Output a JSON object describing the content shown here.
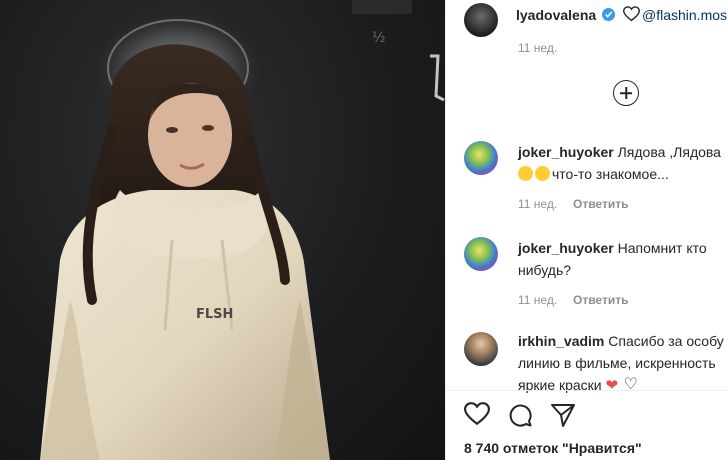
{
  "post": {
    "owner": "lyadovalena",
    "caption_mention": "@flashin.mos",
    "caption_time": "11 нед.",
    "likes_text": "8 740 отметок \"Нравится\""
  },
  "comments": [
    {
      "user": "joker_huyoker",
      "text_line1": "Лядова ,Лядова",
      "text_line2": "что-то знакомое...",
      "time": "11 нед.",
      "reply": "Ответить"
    },
    {
      "user": "joker_huyoker",
      "text_line1": "Напомнит кто",
      "text_line2": "нибудь?",
      "time": "11 нед.",
      "reply": "Ответить"
    },
    {
      "user": "irkhin_vadim",
      "text_line1": "Спасибо за особу",
      "text_line2": "линию в фильме, искренность",
      "text_line3": "яркие краски"
    }
  ],
  "photo": {
    "hoodie_print": "FLSH"
  },
  "icons": {
    "load_more": "plus-circle-icon",
    "like": "heart-icon",
    "comment": "comment-bubble-icon",
    "share": "paper-plane-icon"
  },
  "colors": {
    "verified": "#3897f0",
    "mention": "#00376b",
    "muted": "#8e8e8e",
    "like_red": "#ed4956"
  }
}
